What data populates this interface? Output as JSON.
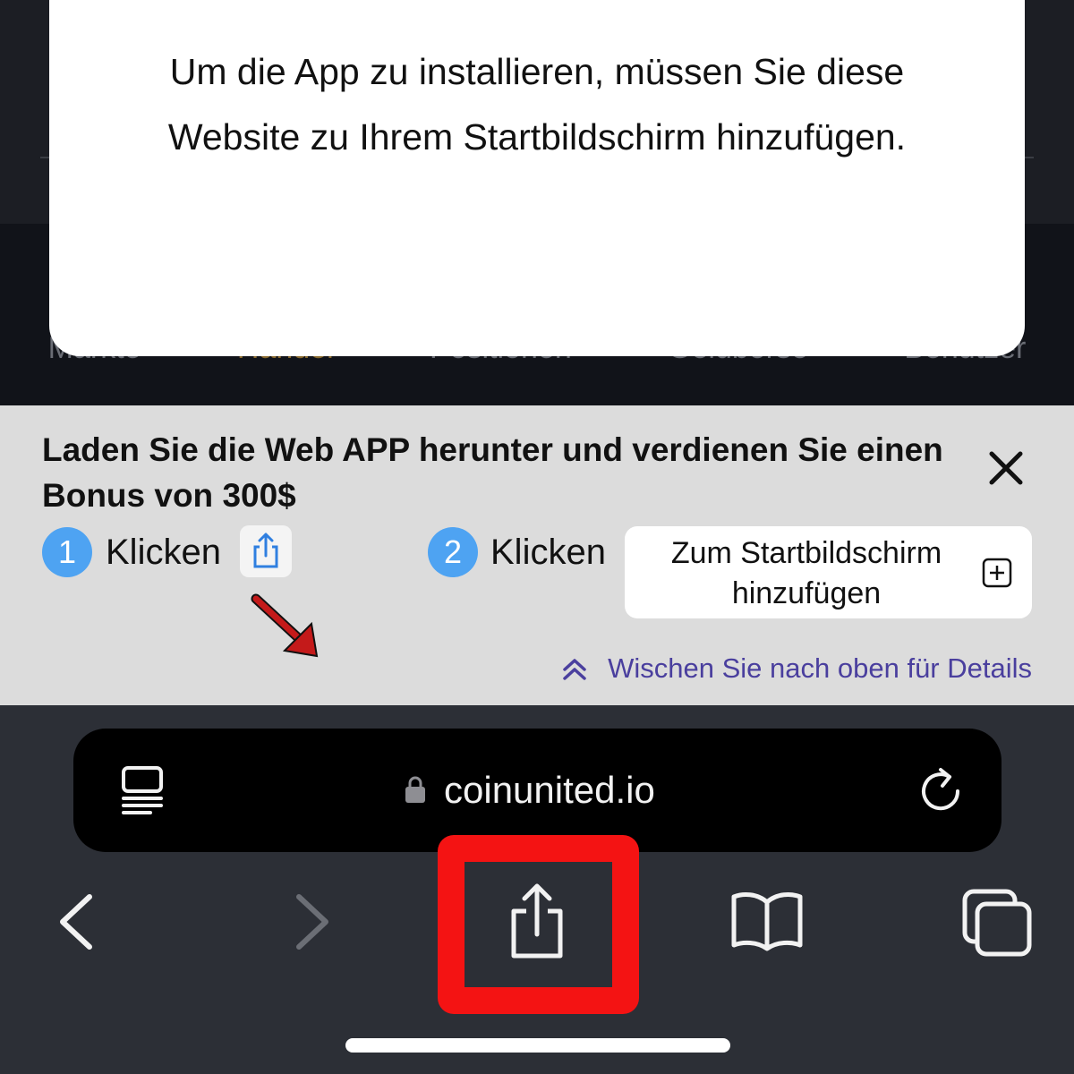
{
  "background": {
    "tabs": [
      "Märkte",
      "Handel",
      "Positionen",
      "Geldbörse",
      "Benutzer"
    ]
  },
  "modal": {
    "message": "Um die App zu installieren, müssen Sie diese Website zu Ihrem Startbildschirm hinzufügen."
  },
  "banner": {
    "title": "Laden Sie die Web APP herunter und verdienen Sie einen Bonus von 300$",
    "step1_number": "1",
    "step1_label": "Klicken",
    "step2_number": "2",
    "step2_label": "Klicken",
    "add_to_home_label": "Zum Startbildschirm hinzufügen",
    "swipe_hint": "Wischen Sie nach oben für Details"
  },
  "browser": {
    "url": "coinunited.io",
    "icons": [
      "reader-icon",
      "lock-icon",
      "reload-icon",
      "back-icon",
      "forward-icon",
      "share-icon",
      "bookmarks-icon",
      "tabs-icon"
    ]
  },
  "colors": {
    "badge": "#4ea3f2",
    "highlight": "#f41313",
    "hint": "#4a3f9e",
    "annotation_arrow": "#c41a1a"
  }
}
